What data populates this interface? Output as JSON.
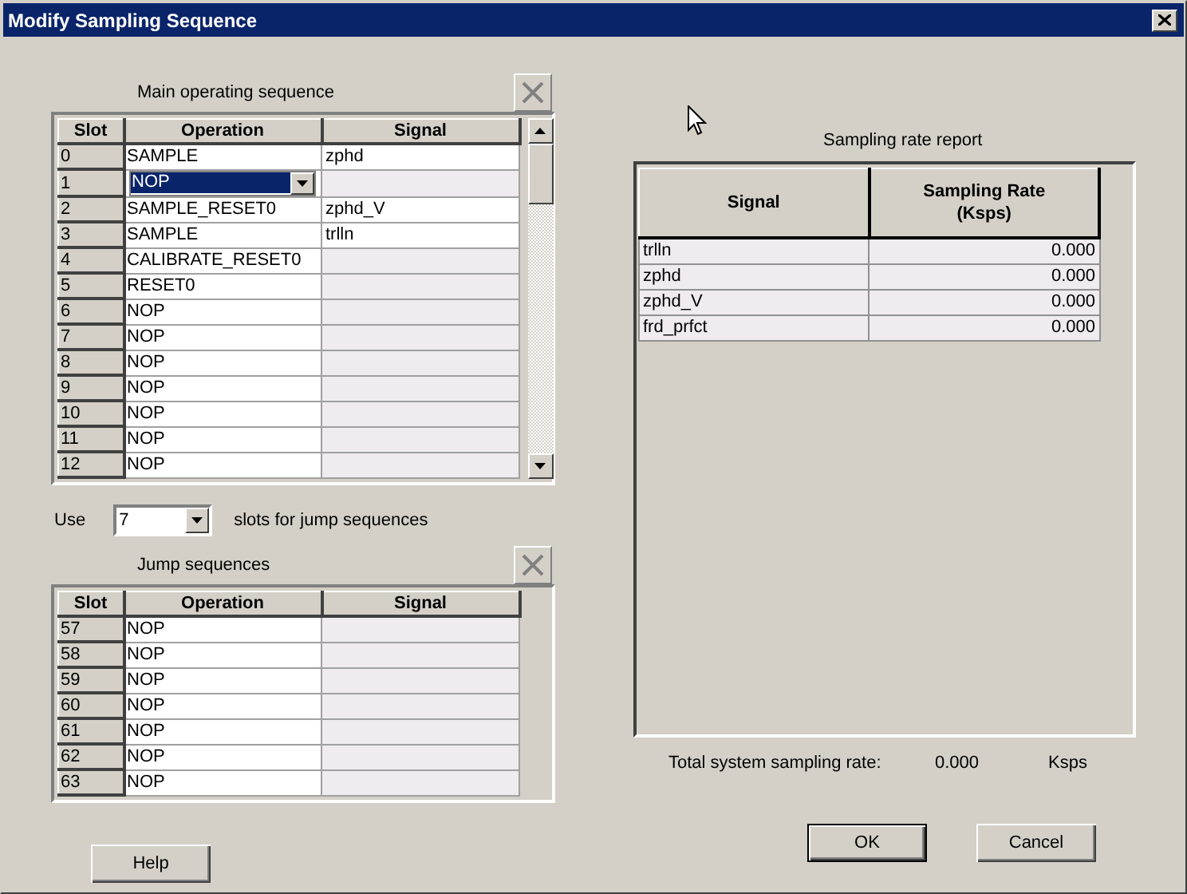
{
  "window": {
    "title": "Modify Sampling Sequence"
  },
  "main_sequence": {
    "label": "Main operating sequence",
    "columns": [
      "Slot",
      "Operation",
      "Signal"
    ],
    "rows": [
      {
        "slot": "0",
        "operation": "SAMPLE",
        "signal": "zphd",
        "editing": false
      },
      {
        "slot": "1",
        "operation": "NOP",
        "editing": true
      },
      {
        "slot": "2",
        "operation": "SAMPLE_RESET0",
        "signal": "zphd_V",
        "editing": false
      },
      {
        "slot": "3",
        "operation": "SAMPLE",
        "signal": "trlln",
        "editing": false
      },
      {
        "slot": "4",
        "operation": "CALIBRATE_RESET0",
        "editing": false
      },
      {
        "slot": "5",
        "operation": "RESET0",
        "editing": false
      },
      {
        "slot": "6",
        "operation": "NOP",
        "editing": false
      },
      {
        "slot": "7",
        "operation": "NOP",
        "editing": false
      },
      {
        "slot": "8",
        "operation": "NOP",
        "editing": false
      },
      {
        "slot": "9",
        "operation": "NOP",
        "editing": false
      },
      {
        "slot": "10",
        "operation": "NOP",
        "editing": false
      },
      {
        "slot": "11",
        "operation": "NOP",
        "editing": false
      },
      {
        "slot": "12",
        "operation": "NOP",
        "editing": false
      }
    ]
  },
  "jump_slots": {
    "label_before": "Use",
    "value": "7",
    "label_after": "slots for jump sequences"
  },
  "jump_sequences": {
    "label": "Jump sequences",
    "columns": [
      "Slot",
      "Operation",
      "Signal"
    ],
    "rows": [
      {
        "slot": "57",
        "operation": "NOP",
        "editing": false
      },
      {
        "slot": "58",
        "operation": "NOP",
        "editing": false
      },
      {
        "slot": "59",
        "operation": "NOP",
        "editing": false
      },
      {
        "slot": "60",
        "operation": "NOP",
        "editing": false
      },
      {
        "slot": "61",
        "operation": "NOP",
        "editing": false
      },
      {
        "slot": "62",
        "operation": "NOP",
        "editing": false
      },
      {
        "slot": "63",
        "operation": "NOP",
        "editing": false
      }
    ]
  },
  "report": {
    "title": "Sampling rate report",
    "columns": [
      "Signal",
      "Sampling Rate (Ksps)"
    ],
    "rows": [
      {
        "signal": "trlln",
        "rate": "0.000"
      },
      {
        "signal": "zphd",
        "rate": "0.000"
      },
      {
        "signal": "zphd_V",
        "rate": "0.000"
      },
      {
        "signal": "frd_prfct",
        "rate": "0.000"
      }
    ]
  },
  "total": {
    "label": "Total system sampling rate:",
    "value": "0.000",
    "unit": "Ksps"
  },
  "left_buttons": [
    {
      "label": "Help",
      "default": false
    }
  ],
  "right_buttons": [
    {
      "label": "OK",
      "default": true
    },
    {
      "label": "Cancel",
      "default": false
    }
  ]
}
